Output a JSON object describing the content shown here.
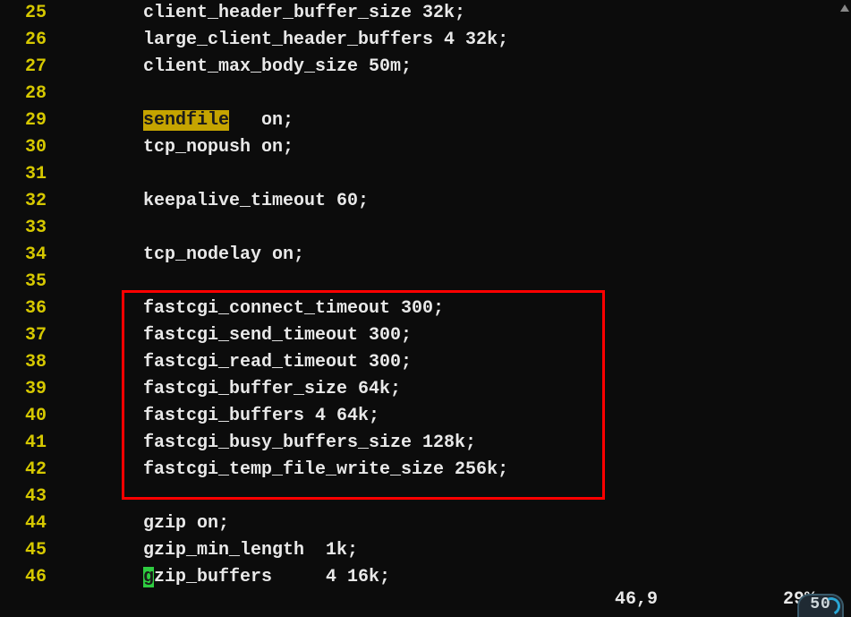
{
  "lines": [
    {
      "n": 25,
      "text": "client_header_buffer_size 32k;"
    },
    {
      "n": 26,
      "text": "large_client_header_buffers 4 32k;"
    },
    {
      "n": 27,
      "text": "client_max_body_size 50m;"
    },
    {
      "n": 28,
      "text": ""
    },
    {
      "n": 29,
      "pre": "",
      "hl": "sendfile",
      "hlClass": "hl-yellow",
      "post": "   on;"
    },
    {
      "n": 30,
      "text": "tcp_nopush on;"
    },
    {
      "n": 31,
      "text": ""
    },
    {
      "n": 32,
      "text": "keepalive_timeout 60;"
    },
    {
      "n": 33,
      "text": ""
    },
    {
      "n": 34,
      "text": "tcp_nodelay on;"
    },
    {
      "n": 35,
      "text": ""
    },
    {
      "n": 36,
      "text": "fastcgi_connect_timeout 300;"
    },
    {
      "n": 37,
      "text": "fastcgi_send_timeout 300;"
    },
    {
      "n": 38,
      "text": "fastcgi_read_timeout 300;"
    },
    {
      "n": 39,
      "text": "fastcgi_buffer_size 64k;"
    },
    {
      "n": 40,
      "text": "fastcgi_buffers 4 64k;"
    },
    {
      "n": 41,
      "text": "fastcgi_busy_buffers_size 128k;"
    },
    {
      "n": 42,
      "text": "fastcgi_temp_file_write_size 256k;"
    },
    {
      "n": 43,
      "text": ""
    },
    {
      "n": 44,
      "text": "gzip on;"
    },
    {
      "n": 45,
      "text": "gzip_min_length  1k;"
    },
    {
      "n": 46,
      "pre": "",
      "hl": "g",
      "hlClass": "hl-green",
      "post": "zip_buffers     4 16k;"
    }
  ],
  "status": {
    "position": "46,9",
    "percent": "29%"
  },
  "badge": {
    "value": "50"
  }
}
